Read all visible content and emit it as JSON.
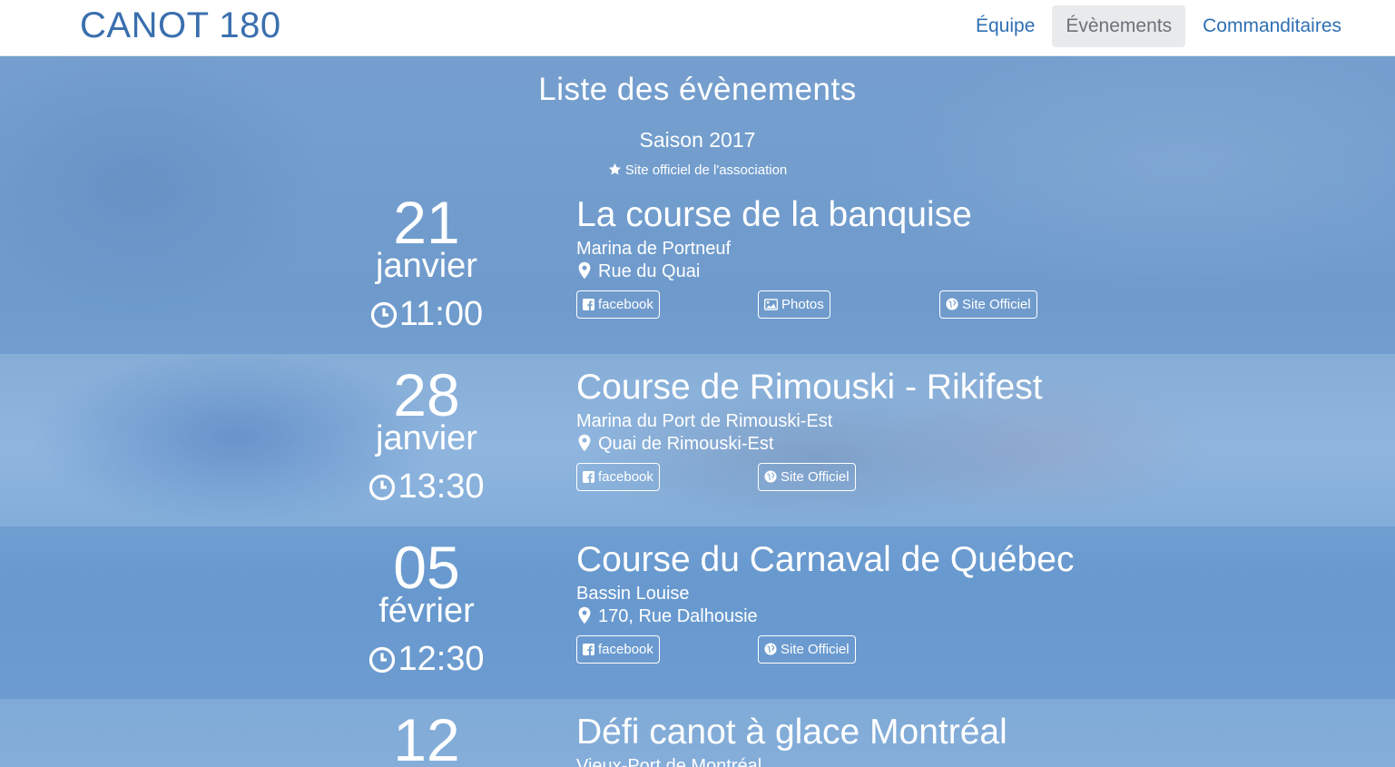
{
  "brand": "CANOT 180",
  "nav": {
    "items": [
      "Équipe",
      "Évènements",
      "Commanditaires"
    ],
    "active_index": 1
  },
  "header": {
    "title": "Liste des évènements",
    "season": "Saison 2017",
    "official_link": "Site officiel de l'association",
    "official_link_icon": "star-icon"
  },
  "events": [
    {
      "day": "21",
      "month": "janvier",
      "time": "11:00",
      "title": "La course de la banquise",
      "venue": "Marina de Portneuf",
      "address": "Rue du Quai",
      "buttons": [
        {
          "label": "facebook",
          "icon": "facebook-icon"
        },
        {
          "label": "Photos",
          "icon": "image-icon"
        },
        {
          "label": "Site Officiel",
          "icon": "globe-icon"
        }
      ]
    },
    {
      "day": "28",
      "month": "janvier",
      "time": "13:30",
      "title": "Course de Rimouski - Rikifest",
      "venue": "Marina du Port de Rimouski-Est",
      "address": "Quai de Rimouski-Est",
      "buttons": [
        {
          "label": "facebook",
          "icon": "facebook-icon"
        },
        {
          "label": "Site Officiel",
          "icon": "globe-icon"
        }
      ]
    },
    {
      "day": "05",
      "month": "février",
      "time": "12:30",
      "title": "Course du Carnaval de Québec",
      "venue": "Bassin Louise",
      "address": "170, Rue Dalhousie",
      "buttons": [
        {
          "label": "facebook",
          "icon": "facebook-icon"
        },
        {
          "label": "Site Officiel",
          "icon": "globe-icon"
        }
      ]
    },
    {
      "day": "12",
      "month": "",
      "time": "",
      "title": "Défi canot à glace Montréal",
      "venue": "Vieux-Port de Montréal",
      "address": "",
      "buttons": []
    }
  ]
}
